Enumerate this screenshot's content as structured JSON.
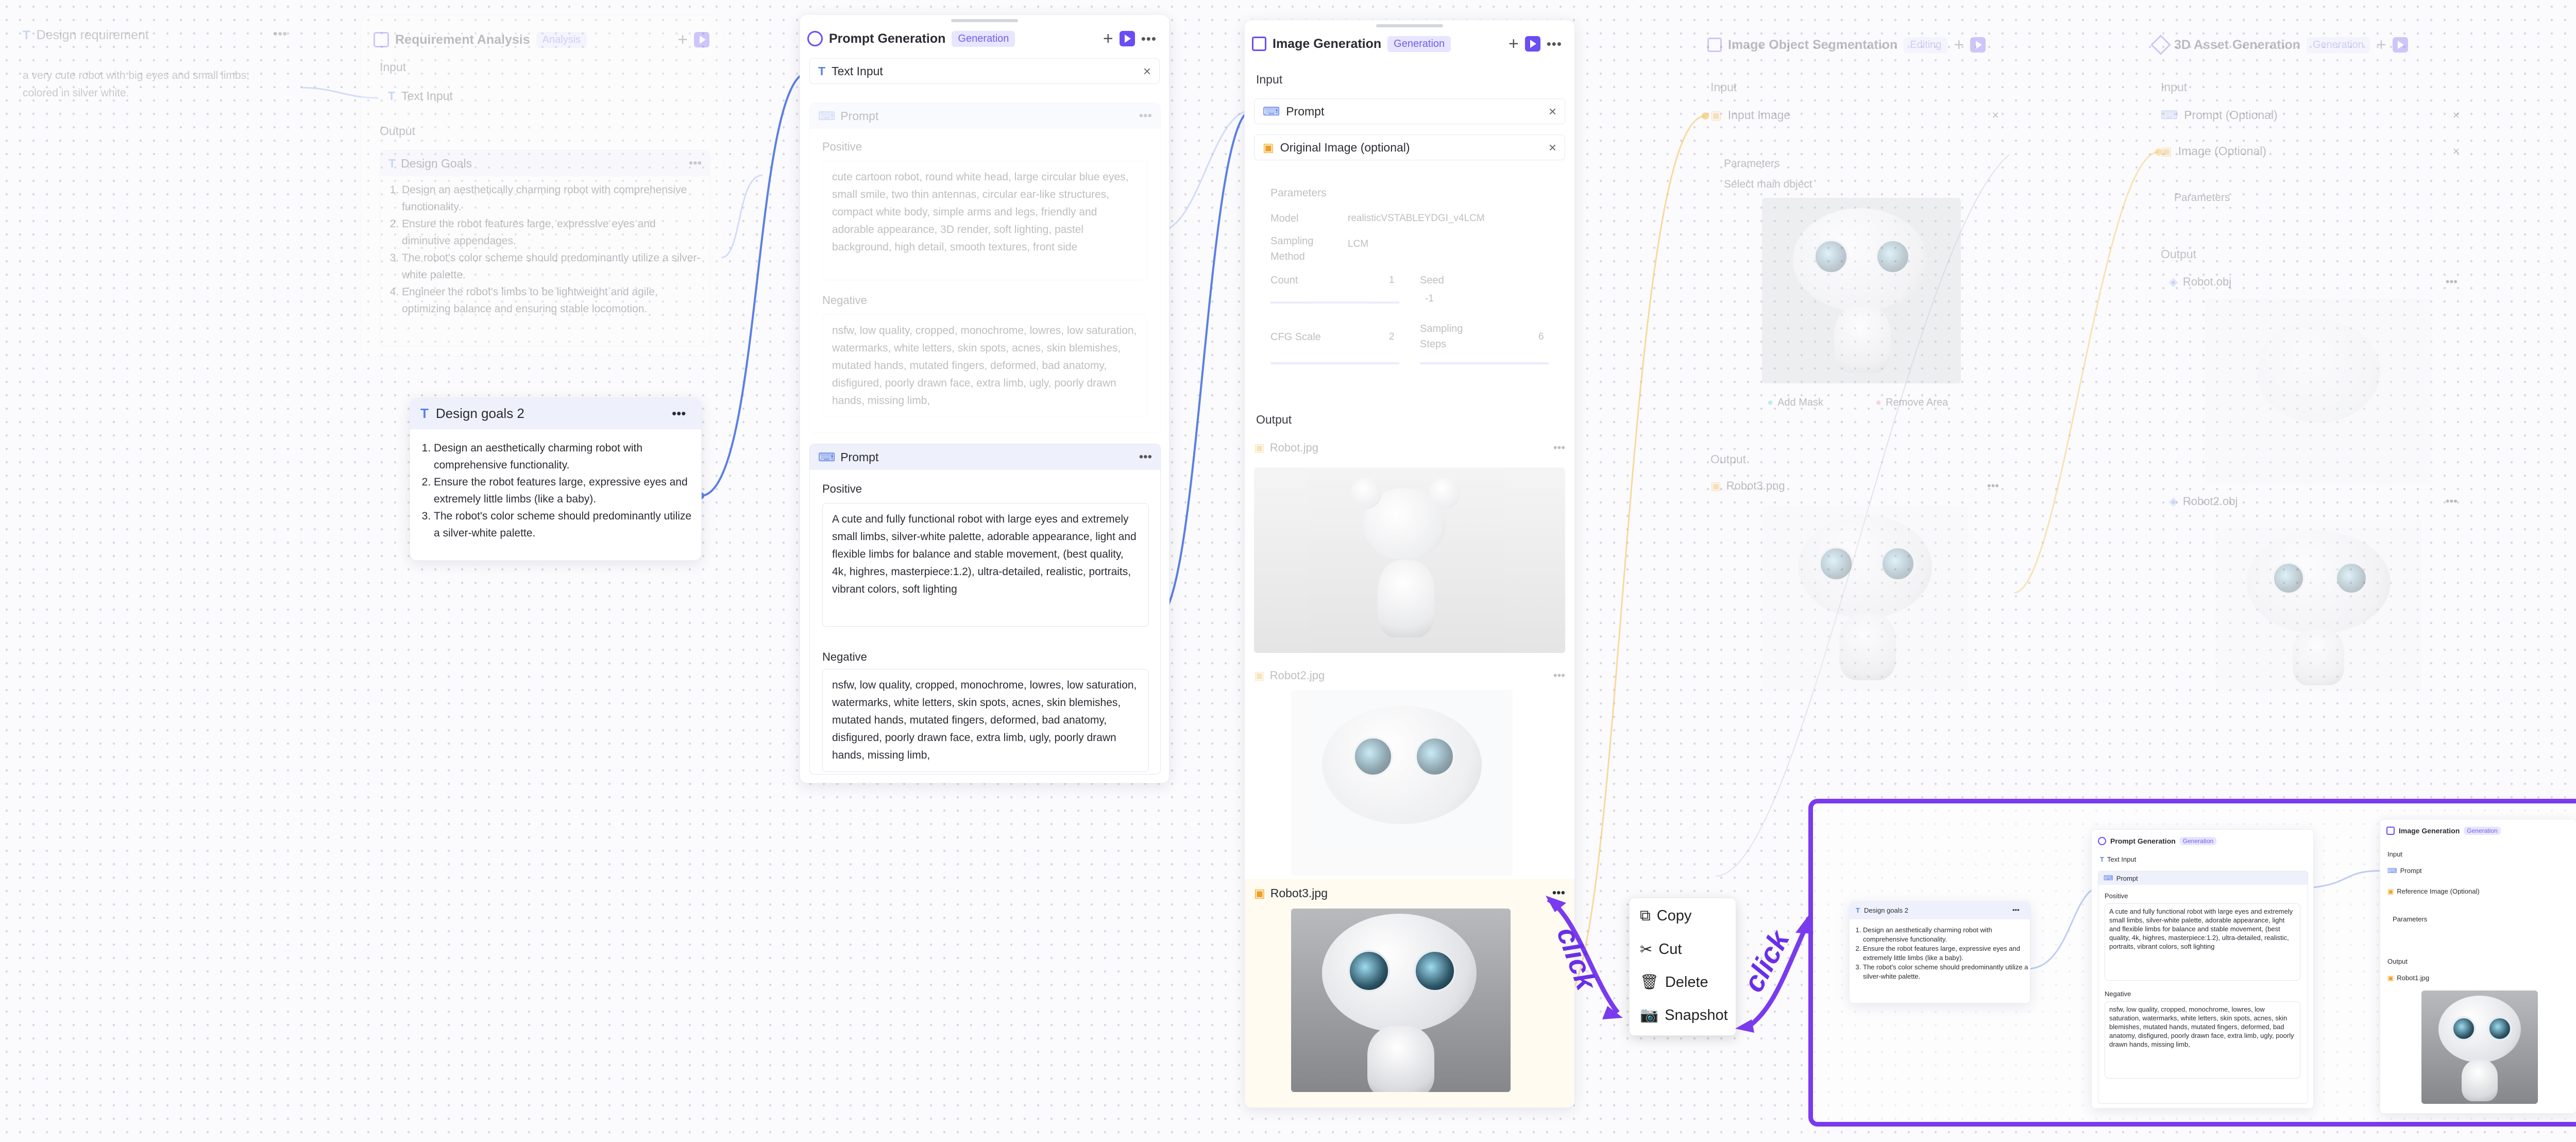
{
  "colors": {
    "accent": "#6a4df5",
    "badge_bg": "#e7e5ff",
    "badge_text": "#6f61e9",
    "wire": "#5b7fe6",
    "wire_orange": "#f7c35c",
    "annotation": "#7a3aed"
  },
  "design_requirement": {
    "title": "Design requirement",
    "text": "a very cute robot with big eyes and small limbs, colored in silver white."
  },
  "requirement_analysis": {
    "title": "Requirement Analysis",
    "badge": "Analysis",
    "input_label": "Input",
    "input_row": "Text Input",
    "output_label": "Output",
    "output_card": "Design Goals",
    "goals": [
      "Design an aesthetically charming robot with comprehensive functionality.",
      "Ensure the robot features large, expressive eyes and diminutive appendages.",
      "The robot's color scheme should predominantly utilize a silver-white palette.",
      "Engineer the robot's limbs to be lightweight and agile, optimizing balance and ensuring stable locomotion."
    ]
  },
  "design_goals_2": {
    "title": "Design goals 2",
    "goals": [
      "Design an aesthetically charming robot with comprehensive functionality.",
      "Ensure the robot features large, expressive eyes and extremely little limbs  (like a baby).",
      "The robot's color scheme should predominantly utilize a silver-white palette."
    ]
  },
  "prompt_generation": {
    "title": "Prompt Generation",
    "badge": "Generation",
    "input_row": "Text Input",
    "faded_prompt": {
      "title": "Prompt",
      "positive_label": "Positive",
      "positive": "cute cartoon robot, round white head, large circular blue eyes, small smile, two thin antennas, circular ear-like structures, compact white body, simple arms and legs, friendly and adorable appearance, 3D render, soft lighting, pastel background, high detail, smooth textures, front side",
      "negative_label": "Negative",
      "negative": "nsfw, low quality, cropped, monochrome, lowres, low saturation, watermarks, white letters, skin spots, acnes, skin blemishes, mutated hands, mutated fingers, deformed, bad anatomy, disfigured, poorly drawn face, extra limb, ugly, poorly drawn hands, missing limb,"
    },
    "prompt": {
      "title": "Prompt",
      "positive_label": "Positive",
      "positive": "A cute and fully functional robot with large eyes and extremely small limbs, silver-white palette, adorable appearance, light and flexible limbs for balance and stable movement, (best quality, 4k, highres, masterpiece:1.2), ultra-detailed, realistic, portraits, vibrant colors, soft lighting",
      "negative_label": "Negative",
      "negative": "nsfw, low quality, cropped, monochrome, lowres, low saturation, watermarks, white letters, skin spots, acnes, skin blemishes, mutated hands, mutated fingers, deformed, bad anatomy, disfigured, poorly drawn face, extra limb, ugly, poorly drawn hands, missing limb,"
    }
  },
  "image_generation": {
    "title": "Image Generation",
    "badge": "Generation",
    "input_label": "Input",
    "prompt_row": "Prompt",
    "image_row": "Original Image (optional)",
    "params_label": "Parameters",
    "model_label": "Model",
    "model_value": "realisticVSTABLEYDGI_v4LCM",
    "sampling_label": "Sampling Method",
    "sampling_value": "LCM",
    "count_label": "Count",
    "count_value": "1",
    "seed_label": "Seed",
    "seed_value": "-1",
    "cfg_label": "CFG Scale",
    "cfg_value": "2",
    "steps_label": "Sampling Steps",
    "steps_value": "6",
    "output_label": "Output",
    "outputs": [
      "Robot.jpg",
      "Robot2.jpg",
      "Robot3.jpg"
    ]
  },
  "context_menu": {
    "items": [
      "Copy",
      "Cut",
      "Delete",
      "Snapshot"
    ]
  },
  "annotations": {
    "click1": "click",
    "click2": "click"
  },
  "segmentation": {
    "title": "Image Object Segmentation",
    "badge": "Editing",
    "input_label": "Input",
    "input_row": "Input Image",
    "params_label": "Parameters",
    "select_label": "Select main object",
    "add_mask": "Add Mask",
    "remove_area": "Remove Area",
    "output_label": "Output",
    "output_file": "Robot3.png"
  },
  "asset_generation": {
    "title": "3D Asset Generation",
    "badge": "Generation",
    "input_label": "Input",
    "prompt_row": "Prompt (Optional)",
    "image_row": "Image (Optional)",
    "params_label": "Parameters",
    "output_label": "Output",
    "outputs": [
      "Robot.obj",
      "Robot2.obj"
    ]
  },
  "snapshot": {
    "goals_title": "Design goals 2",
    "goals": [
      "Design an aesthetically charming robot with comprehensive functionality.",
      "Ensure the robot features large, expressive eyes and extremely little limbs (like a baby).",
      "The robot's color scheme should predominantly utilize a silver-white palette."
    ],
    "pg_title": "Prompt Generation",
    "pg_badge": "Generation",
    "pg_input": "Text Input",
    "pg_prompt": "Prompt",
    "pg_positive_label": "Positive",
    "pg_positive": "A cute and fully functional robot with large eyes and extremely small limbs, silver-white palette, adorable appearance, light and flexible limbs for balance and stable movement, (best quality, 4k, highres, masterpiece:1.2), ultra-detailed, realistic, portraits, vibrant colors, soft lighting",
    "pg_negative_label": "Negative",
    "pg_negative": "nsfw, low quality, cropped, monochrome, lowres, low saturation, watermarks, white letters, skin spots, acnes, skin blemishes, mutated hands, mutated fingers, deformed, bad anatomy, disfigured, poorly drawn face, extra limb, ugly, poorly drawn hands, missing limb,",
    "ig_title": "Image Generation",
    "ig_badge": "Generation",
    "ig_input": "Input",
    "ig_prompt": "Prompt",
    "ig_ref": "Reference Image (Optional)",
    "ig_params": "Parameters",
    "ig_output": "Output",
    "ig_file": "Robot1.jpg"
  }
}
